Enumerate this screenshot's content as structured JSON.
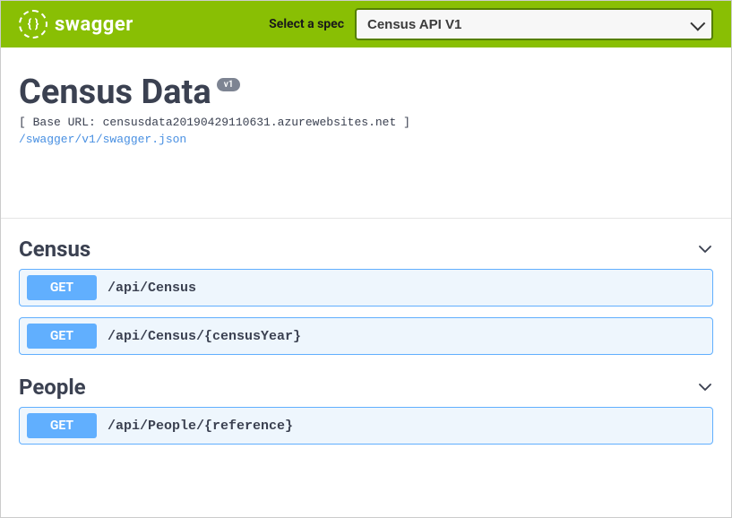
{
  "topbar": {
    "brand": "swagger",
    "spec_label": "Select a spec",
    "spec_selected": "Census API V1"
  },
  "info": {
    "title": "Census Data",
    "version": "v1",
    "base_url_prefix": "[ Base URL: ",
    "base_url": "censusdata20190429110631.azurewebsites.net",
    "base_url_suffix": " ]",
    "swagger_json_path": "/swagger/v1/swagger.json"
  },
  "tags": [
    {
      "name": "Census",
      "ops": [
        {
          "method": "GET",
          "path": "/api/Census"
        },
        {
          "method": "GET",
          "path": "/api/Census/{censusYear}"
        }
      ]
    },
    {
      "name": "People",
      "ops": [
        {
          "method": "GET",
          "path": "/api/People/{reference}"
        }
      ]
    }
  ]
}
